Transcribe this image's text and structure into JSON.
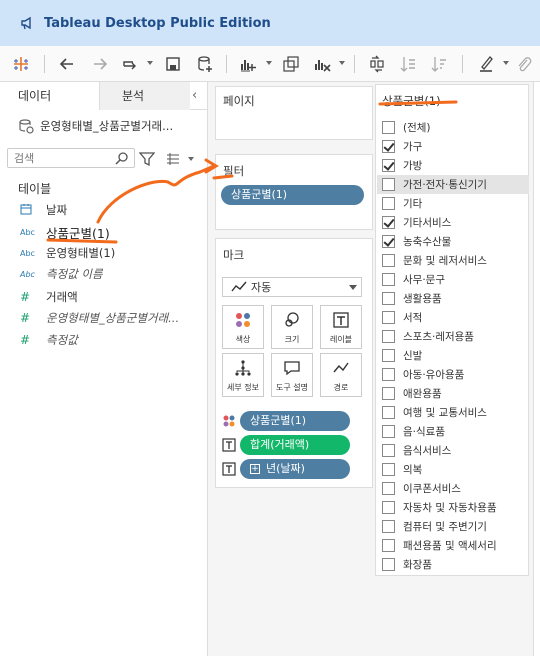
{
  "app": {
    "title": "Tableau Desktop Public Edition"
  },
  "colors": {
    "titlebar": "#cfe4f9",
    "pill_dimension": "#4e7ea1",
    "pill_measure": "#12b76a",
    "annotation": "#f26b1d"
  },
  "toolbar": {
    "icons": [
      "tableau-logo-icon",
      "back-icon",
      "forward-icon",
      "redo-icon",
      "save-icon",
      "new-datasource-icon",
      "new-worksheet-icon",
      "duplicate-icon",
      "clear-icon",
      "swap-icon",
      "sort-ascending-icon",
      "sort-descending-icon",
      "highlight-icon",
      "attach-icon"
    ]
  },
  "left_panel": {
    "tabs": {
      "data": "데이터",
      "analysis": "분석"
    },
    "datasource": "운영형태별_상품군별거래...",
    "search": {
      "placeholder": "검색"
    },
    "tables_header": "테이블",
    "fields": [
      {
        "type": "date",
        "label": "날짜"
      },
      {
        "type": "Abc",
        "label": "상품군별(1)"
      },
      {
        "type": "Abc",
        "label": "운영형태별(1)"
      },
      {
        "type": "Abc",
        "label": "측정값 이름"
      },
      {
        "type": "#",
        "label": "거래액"
      },
      {
        "type": "#",
        "label": "운영형태별_상품군별거래..."
      },
      {
        "type": "#",
        "label": "측정값"
      }
    ]
  },
  "pages": {
    "title": "페이지"
  },
  "filters": {
    "title": "필터",
    "pill": "상품군별(1)"
  },
  "marks": {
    "title": "마크",
    "mark_type": "자동",
    "buttons": {
      "color": "색상",
      "size": "크기",
      "label": "레이블",
      "detail": "세부 정보",
      "tooltip": "도구 설명",
      "path": "경로"
    },
    "fields": {
      "color_field": "상품군별(1)",
      "label_measure": "합계(거래액)",
      "label_date": "년(날짜)"
    }
  },
  "filter_card": {
    "title": "상품군별(1)",
    "options": [
      {
        "label": "(전체)",
        "checked": false
      },
      {
        "label": "가구",
        "checked": true
      },
      {
        "label": "가방",
        "checked": true
      },
      {
        "label": "가전·전자·통신기기",
        "checked": false
      },
      {
        "label": "기타",
        "checked": false
      },
      {
        "label": "기타서비스",
        "checked": true
      },
      {
        "label": "농축수산물",
        "checked": true
      },
      {
        "label": "문화 및 레저서비스",
        "checked": false
      },
      {
        "label": "사무·문구",
        "checked": false
      },
      {
        "label": "생활용품",
        "checked": false
      },
      {
        "label": "서적",
        "checked": false
      },
      {
        "label": "스포츠·레저용품",
        "checked": false
      },
      {
        "label": "신발",
        "checked": false
      },
      {
        "label": "아동·유아용품",
        "checked": false
      },
      {
        "label": "애완용품",
        "checked": false
      },
      {
        "label": "여행 및 교통서비스",
        "checked": false
      },
      {
        "label": "음·식료품",
        "checked": false
      },
      {
        "label": "음식서비스",
        "checked": false
      },
      {
        "label": "의복",
        "checked": false
      },
      {
        "label": "이쿠폰서비스",
        "checked": false
      },
      {
        "label": "자동차 및 자동차용품",
        "checked": false
      },
      {
        "label": "컴퓨터 및 주변기기",
        "checked": false
      },
      {
        "label": "패션용품 및 액세서리",
        "checked": false
      },
      {
        "label": "화장품",
        "checked": false
      }
    ]
  }
}
